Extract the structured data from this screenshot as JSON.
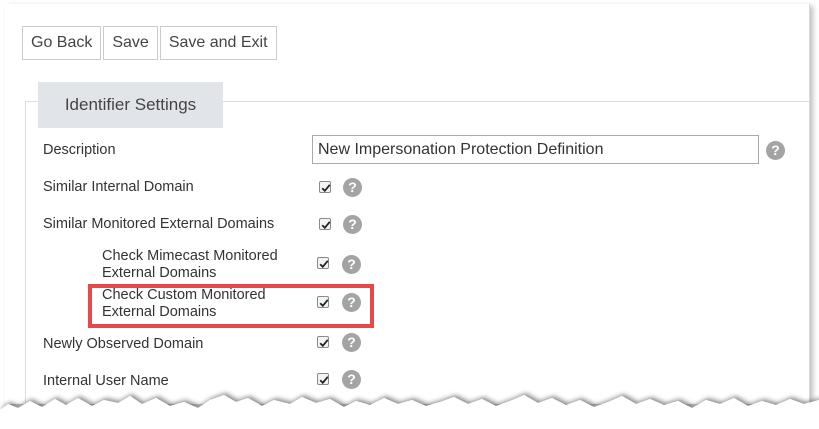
{
  "toolbar": {
    "go_back_label": "Go Back",
    "save_label": "Save",
    "save_exit_label": "Save and Exit"
  },
  "section": {
    "title": "Identifier Settings"
  },
  "form": {
    "description": {
      "label": "Description",
      "value": "New Impersonation Protection Definition"
    },
    "rows": [
      {
        "label": "Similar Internal Domain",
        "checked": true
      },
      {
        "label": "Similar Monitored External Domains",
        "checked": true
      },
      {
        "label_line1": "Check Mimecast Monitored",
        "label_line2": "External Domains",
        "checked": true
      },
      {
        "label_line1": "Check Custom Monitored",
        "label_line2": "External Domains",
        "checked": true
      },
      {
        "label": "Newly Observed Domain",
        "checked": true
      },
      {
        "label": "Internal User Name",
        "checked": true
      }
    ],
    "help_glyph": "?"
  },
  "icons": {
    "help": "help-icon",
    "checkbox": "checkmark-icon"
  },
  "colors": {
    "highlight": "#e8484a",
    "section_tab": "#e1e5ea",
    "help_icon": "#a4a4a4"
  }
}
